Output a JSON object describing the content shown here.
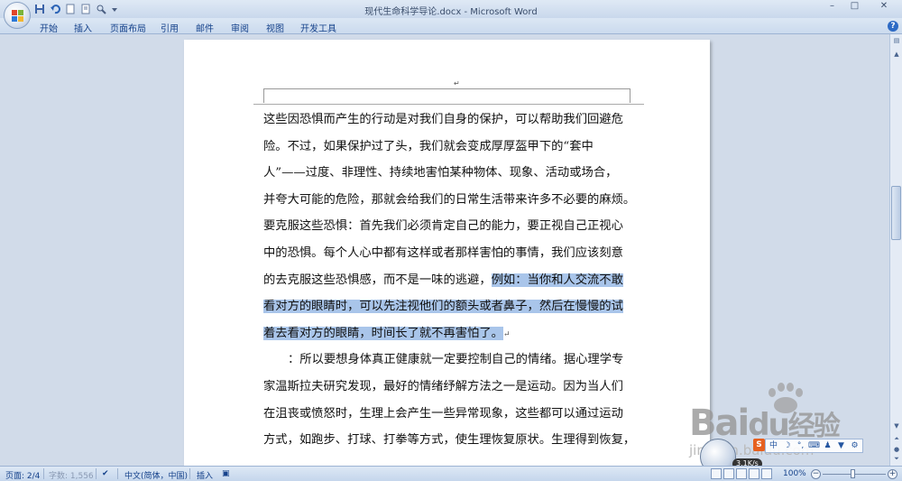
{
  "window": {
    "title": "现代生命科学导论.docx - Microsoft Word",
    "minimize": "–",
    "maximize": "□",
    "close": "✕"
  },
  "quick_access": [
    "save-icon",
    "undo-icon",
    "new-doc-icon",
    "print-preview-icon",
    "customize-icon"
  ],
  "ribbon": {
    "tabs": [
      "开始",
      "插入",
      "页面布局",
      "引用",
      "邮件",
      "审阅",
      "视图",
      "开发工具"
    ],
    "help": "?"
  },
  "document": {
    "header_mark": "↵",
    "lines": [
      "这些因恐惧而产生的行动是对我们自身的保护，可以帮助我们回避危",
      "险。不过，如果保护过了头，我们就会变成厚厚盔甲下的“套中",
      "人”——过度、非理性、持续地害怕某种物体、现象、活动或场合，",
      "并夸大可能的危险，那就会给我们的日常生活带来许多不必要的麻烦。",
      "要克服这些恐惧：首先我们必须肯定自己的能力，要正视自己正视心",
      "中的恐惧。每个人心中都有这样或者那样害怕的事情，我们应该刻意"
    ],
    "line7_plain": "的去克服这些恐惧感，而不是一味的逃避，",
    "line7_sel": "例如：当你和人交流不敢",
    "line8_sel": "看对方的眼睛时，可以先注视他们的额头或者鼻子，然后在慢慢的试",
    "line9_sel": "着去看对方的眼睛，时间长了就不再害怕了。",
    "line9_mark": "↵",
    "lines_after": [
      "：所以要想身体真正健康就一定要控制自己的情绪。据心理学专",
      "家温斯拉夫研究发现，最好的情绪纾解方法之一是运动。因为当人们",
      "在沮丧或愤怒时，生理上会产生一些异常现象，这些都可以通过运动",
      "方式，如跑步、打球、打拳等方式，使生理恢复原状。生理得到恢复，"
    ]
  },
  "watermark": {
    "brand": "Bai",
    "brand2": "经验",
    "site": "jingyan.baidu.com"
  },
  "overlay": {
    "speed": "3.1K/s",
    "ime_s": "S"
  },
  "statusbar": {
    "page": "页面: 2/4",
    "words": "字数: 1,556",
    "language": "中文(简体，中国)",
    "insert": "插入",
    "zoom": "100%",
    "zoom_minus": "−",
    "zoom_plus": "+"
  },
  "colors": {
    "selection": "#a9c5ea",
    "ribbon_text": "#15428b"
  }
}
